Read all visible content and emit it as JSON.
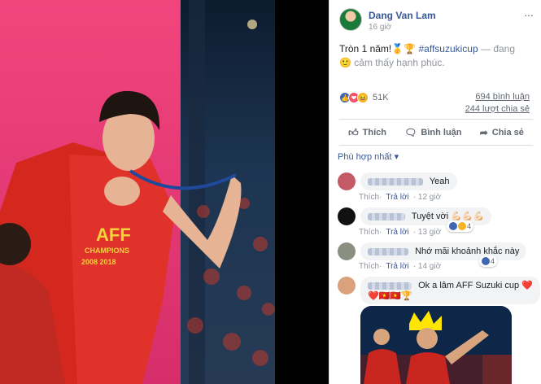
{
  "post": {
    "author": "Dang Van Lam",
    "time": "16 giờ",
    "more_label": "···",
    "text_main": "Tròn 1 năm!🥇🏆",
    "hashtag": "#affsuzukicup",
    "feeling": "— đang 🙂 cảm thấy hạnh phúc."
  },
  "reactions": {
    "count": "51K",
    "comments": "694 bình luận",
    "shares": "244 lượt chia sẻ",
    "like_glyph": "👍",
    "love_glyph": "❤",
    "haha_glyph": "😆"
  },
  "actions": {
    "like": "Thích",
    "comment": "Bình luận",
    "share": "Chia sẻ"
  },
  "sort_label": "Phù hợp nhất ▾",
  "comments": [
    {
      "text": "Yeah",
      "like": "Thích",
      "reply": "Trả lời",
      "time": "12 giờ"
    },
    {
      "text": "Tuyệt vời 💪🏻💪🏻💪🏻",
      "like": "Thích",
      "reply": "Trả lời",
      "time": "13 giờ",
      "reaction_count": "4"
    },
    {
      "text": "Nhớ mãi khoảnh khắc này",
      "like": "Thích",
      "reply": "Trả lời",
      "time": "14 giờ",
      "reaction_count": "4"
    },
    {
      "text": "Ok a lâm AFF Suzuki cup ❤️",
      "text2": "❤️🇻🇳🇻🇳🏆"
    }
  ],
  "photo": {
    "shirt_logo": "AFF",
    "shirt_text": "CHAMPIONS",
    "shirt_year": "2008  2018"
  },
  "colors": {
    "fb_blue": "#385898",
    "meta_gray": "#90949c",
    "pink_bg": "#e8417a",
    "jersey_red": "#d4281e"
  }
}
